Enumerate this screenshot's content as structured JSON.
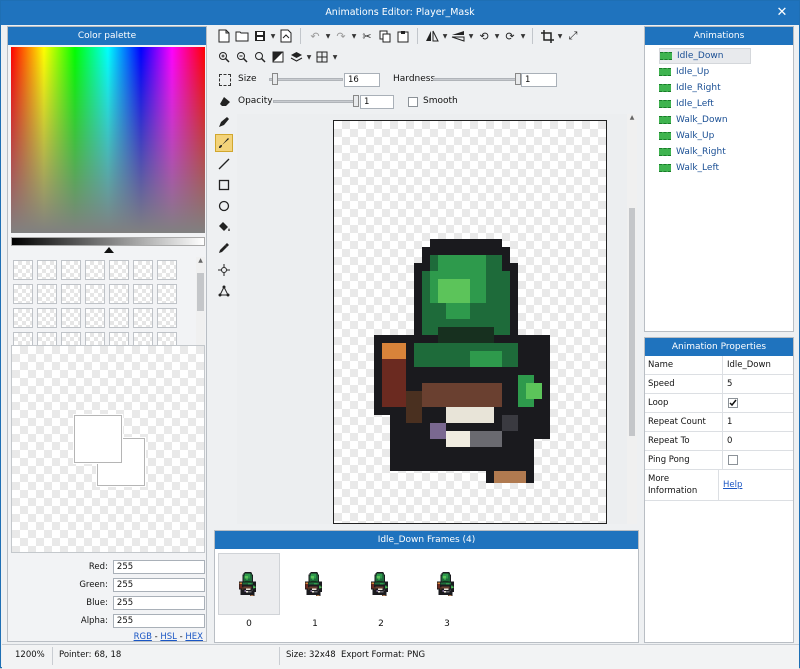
{
  "window": {
    "title": "Animations Editor: Player_Mask",
    "close_glyph": "✕"
  },
  "palette": {
    "header": "Color palette"
  },
  "color_values": {
    "red_label": "Red:",
    "red": "255",
    "green_label": "Green:",
    "green": "255",
    "blue_label": "Blue:",
    "blue": "255",
    "alpha_label": "Alpha:",
    "alpha": "255",
    "mode_rgb": "RGB",
    "sep1": " - ",
    "mode_hsl": "HSL",
    "sep2": " - ",
    "mode_hex": "HEX"
  },
  "brush": {
    "size_label": "Size",
    "size_value": "16",
    "size_level": 0.04,
    "hardness_label": "Hardness",
    "hardness_value": "1",
    "hardness_level": 1.0,
    "opacity_label": "Opacity",
    "opacity_value": "1",
    "opacity_level": 1.0,
    "smooth_label": "Smooth"
  },
  "animations": {
    "header": "Animations",
    "items": [
      "Idle_Down",
      "Idle_Up",
      "Idle_Right",
      "Idle_Left",
      "Walk_Down",
      "Walk_Up",
      "Walk_Right",
      "Walk_Left"
    ],
    "selected": "Idle_Down"
  },
  "properties": {
    "header": "Animation Properties",
    "rows": [
      {
        "name": "Name",
        "value": "Idle_Down"
      },
      {
        "name": "Speed",
        "value": "5"
      },
      {
        "name": "Loop",
        "checked": true
      },
      {
        "name": "Repeat Count",
        "value": "1"
      },
      {
        "name": "Repeat To",
        "value": "0"
      },
      {
        "name": "Ping Pong",
        "checked": false
      },
      {
        "name": "More Information",
        "link": "Help"
      }
    ]
  },
  "frames": {
    "header": "Idle_Down Frames (4)",
    "labels": [
      "0",
      "1",
      "2",
      "3"
    ]
  },
  "status": {
    "zoom": "1200%",
    "pointer": "Pointer: 68, 18",
    "size": "Size: 32x48",
    "format": "Export Format: PNG"
  },
  "colors": {
    "accent": "#1f73be",
    "hood_dark": "#1e6b3a",
    "hood_mid": "#2e9a4c",
    "hood_light": "#5cc45a",
    "outline": "#1a1a1e"
  }
}
